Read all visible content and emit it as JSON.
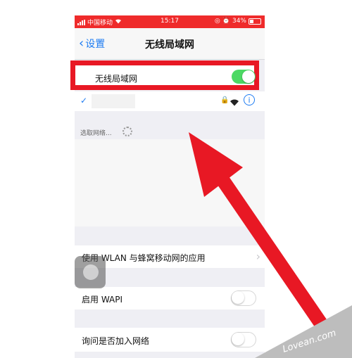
{
  "status_bar": {
    "carrier": "中国移动",
    "time": "15:17",
    "battery": "34%"
  },
  "nav": {
    "back_label": "设置",
    "title": "无线局域网"
  },
  "wifi_row": {
    "label": "无线局域网",
    "enabled": true
  },
  "choose_network": {
    "label": "选取网络..."
  },
  "settings": {
    "apps_using_wlan": "使用 WLAN 与蜂窝移动网的应用",
    "enable_wapi": "启用 WAPI",
    "ask_to_join": "询问是否加入网络"
  },
  "watermark": "Lovean.com",
  "colors": {
    "accent_blue": "#1e7cf2",
    "toggle_on": "#4cd964",
    "highlight_red": "#e81824",
    "status_bar": "#ef2b2b"
  }
}
